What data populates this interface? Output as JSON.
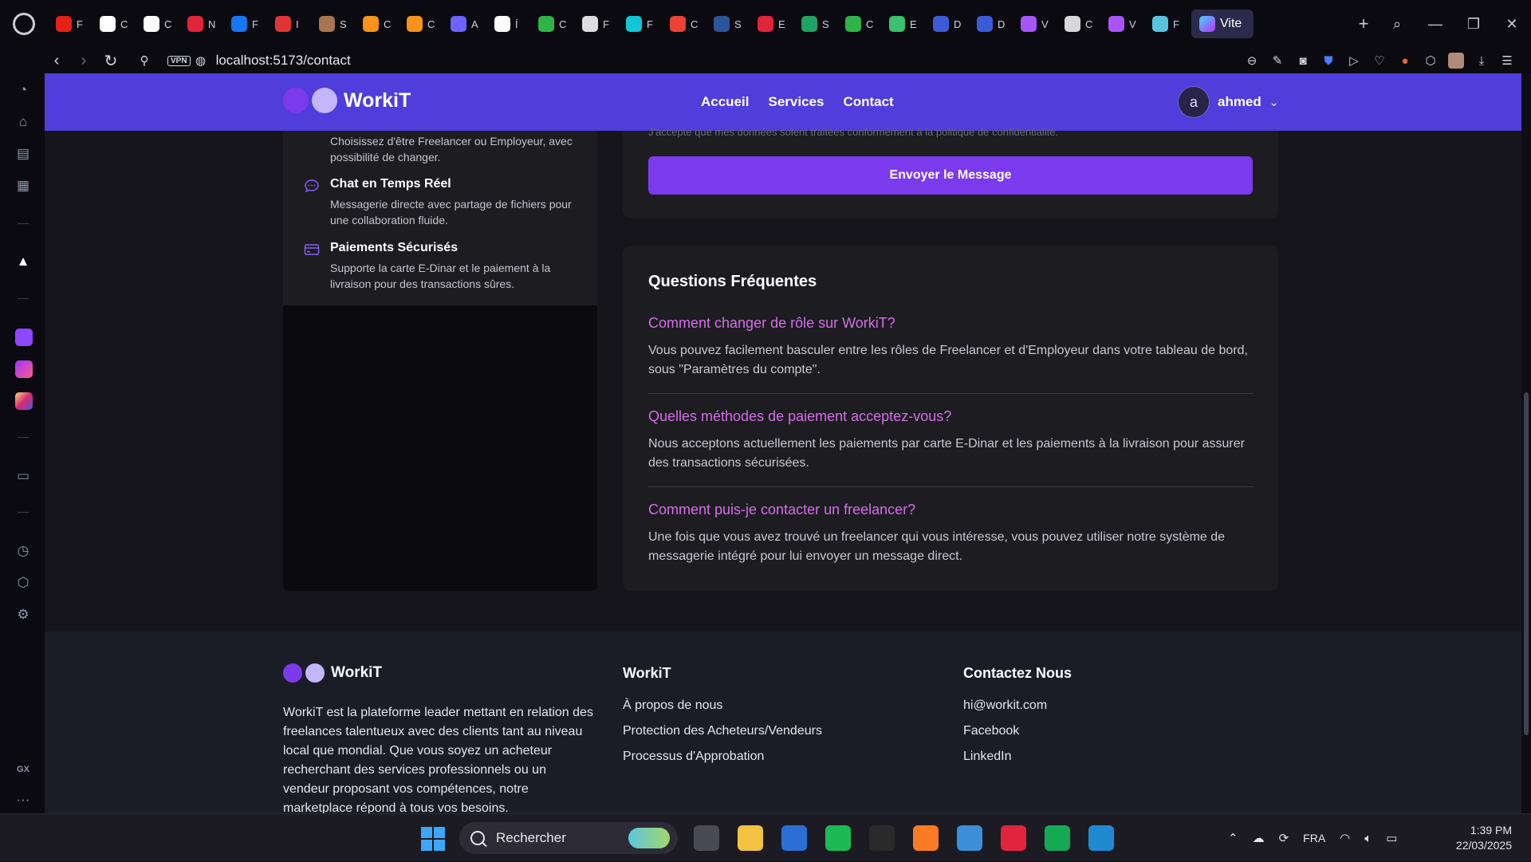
{
  "browser": {
    "active_tab_label": "Vite",
    "tabs": [
      {
        "icon": "youtube-icon",
        "letter": "F",
        "color": "#e62117"
      },
      {
        "icon": "github-icon",
        "letter": "C",
        "color": "#ffffff"
      },
      {
        "icon": "github-icon",
        "letter": "C",
        "color": "#ffffff"
      },
      {
        "icon": "red-app-icon",
        "letter": "N",
        "color": "#e0243b"
      },
      {
        "icon": "facebook-icon",
        "letter": "F",
        "color": "#1877f2"
      },
      {
        "icon": "speed-icon",
        "letter": "I",
        "color": "#e03535"
      },
      {
        "icon": "image-icon",
        "letter": "S",
        "color": "#a77650"
      },
      {
        "icon": "orange-app-icon",
        "letter": "C",
        "color": "#f7931a"
      },
      {
        "icon": "orange-app-icon",
        "letter": "C",
        "color": "#f7931a"
      },
      {
        "icon": "triangle-icon",
        "letter": "A",
        "color": "#6c63ff"
      },
      {
        "icon": "notion-icon",
        "letter": "Í",
        "color": "#ffffff"
      },
      {
        "icon": "leaf-icon",
        "letter": "C",
        "color": "#2fb44a"
      },
      {
        "icon": "openai-icon",
        "letter": "F",
        "color": "#dddddd"
      },
      {
        "icon": "cyan-app-icon",
        "letter": "F",
        "color": "#10c7d8"
      },
      {
        "icon": "gmail-icon",
        "letter": "C",
        "color": "#ea4335"
      },
      {
        "icon": "word-icon",
        "letter": "S",
        "color": "#2b579a"
      },
      {
        "icon": "app-icon",
        "letter": "E",
        "color": "#e0243b"
      },
      {
        "icon": "app-icon",
        "letter": "S",
        "color": "#21a366"
      },
      {
        "icon": "leaf-icon",
        "letter": "C",
        "color": "#2fb44a"
      },
      {
        "icon": "app-icon",
        "letter": "E",
        "color": "#3ac26e"
      },
      {
        "icon": "app-icon",
        "letter": "D",
        "color": "#3c5bd8"
      },
      {
        "icon": "app-icon",
        "letter": "D",
        "color": "#3c5bd8"
      },
      {
        "icon": "vite-icon",
        "letter": "V",
        "color": "#a855f7"
      },
      {
        "icon": "app-icon",
        "letter": "C",
        "color": "#d8d8d8"
      },
      {
        "icon": "vite-icon",
        "letter": "V",
        "color": "#a855f7"
      },
      {
        "icon": "gear-icon",
        "letter": "F",
        "color": "#58c4dc"
      }
    ],
    "url": "localhost:5173/contact",
    "vpn_label": "VPN"
  },
  "site": {
    "brand": "WorkiT",
    "nav": [
      "Accueil",
      "Services",
      "Contact"
    ],
    "user": {
      "initial": "a",
      "name": "ahmed"
    },
    "colors": {
      "header": "#4f3ddc",
      "accent": "#7c3aed",
      "faq_question": "#d56ee6"
    }
  },
  "features": {
    "partial_desc": "Choisissez d'être Freelancer ou Employeur, avec possibilité de changer.",
    "items": [
      {
        "title": "Chat en Temps Réel",
        "desc": "Messagerie directe avec partage de fichiers pour une collaboration fluide.",
        "icon": "chat-icon"
      },
      {
        "title": "Paiements Sécurisés",
        "desc": "Supporte la carte E-Dinar et le paiement à la livraison pour des transactions sûres.",
        "icon": "credit-card-icon"
      }
    ]
  },
  "form": {
    "consent": "J'accepte que mes données soient traitées conformément à la politique de confidentialité.",
    "submit_label": "Envoyer le Message"
  },
  "faq": {
    "title": "Questions Fréquentes",
    "items": [
      {
        "q": "Comment changer de rôle sur WorkiT?",
        "a": "Vous pouvez facilement basculer entre les rôles de Freelancer et d'Employeur dans votre tableau de bord, sous \"Paramètres du compte\"."
      },
      {
        "q": "Quelles méthodes de paiement acceptez-vous?",
        "a": "Nous acceptons actuellement les paiements par carte E-Dinar et les paiements à la livraison pour assurer des transactions sécurisées."
      },
      {
        "q": "Comment puis-je contacter un freelancer?",
        "a": "Une fois que vous avez trouvé un freelancer qui vous intéresse, vous pouvez utiliser notre système de messagerie intégré pour lui envoyer un message direct."
      }
    ]
  },
  "footer": {
    "brand": "WorkiT",
    "desc": "WorkiT est la plateforme leader mettant en relation des freelances talentueux avec des clients tant au niveau local que mondial. Que vous soyez un acheteur recherchant des services professionnels ou un vendeur proposant vos compétences, notre marketplace répond à tous vos besoins.",
    "col2_title": "WorkiT",
    "col2_links": [
      "À propos de nous",
      "Protection des Acheteurs/Vendeurs",
      "Processus d'Approbation"
    ],
    "col3_title": "Contactez Nous",
    "col3_links": [
      "hi@workit.com",
      "Facebook",
      "LinkedIn"
    ]
  },
  "taskbar": {
    "search_placeholder": "Rechercher",
    "language": "FRA",
    "time": "1:39 PM",
    "date": "22/03/2025",
    "apps": [
      {
        "name": "task-view-icon",
        "color": "#4a4a55"
      },
      {
        "name": "file-explorer-icon",
        "color": "#f4c242"
      },
      {
        "name": "ms-store-icon",
        "color": "#2b6fd6"
      },
      {
        "name": "spotify-icon",
        "color": "#1db954"
      },
      {
        "name": "chatgpt-icon",
        "color": "#2a2a2a"
      },
      {
        "name": "xampp-icon",
        "color": "#fb7a24"
      },
      {
        "name": "notepad-icon",
        "color": "#3d8fd8"
      },
      {
        "name": "opera-icon",
        "color": "#e0243b"
      },
      {
        "name": "mongodb-compass-icon",
        "color": "#13aa52"
      },
      {
        "name": "vscode-icon",
        "color": "#1f8ad2"
      }
    ]
  }
}
